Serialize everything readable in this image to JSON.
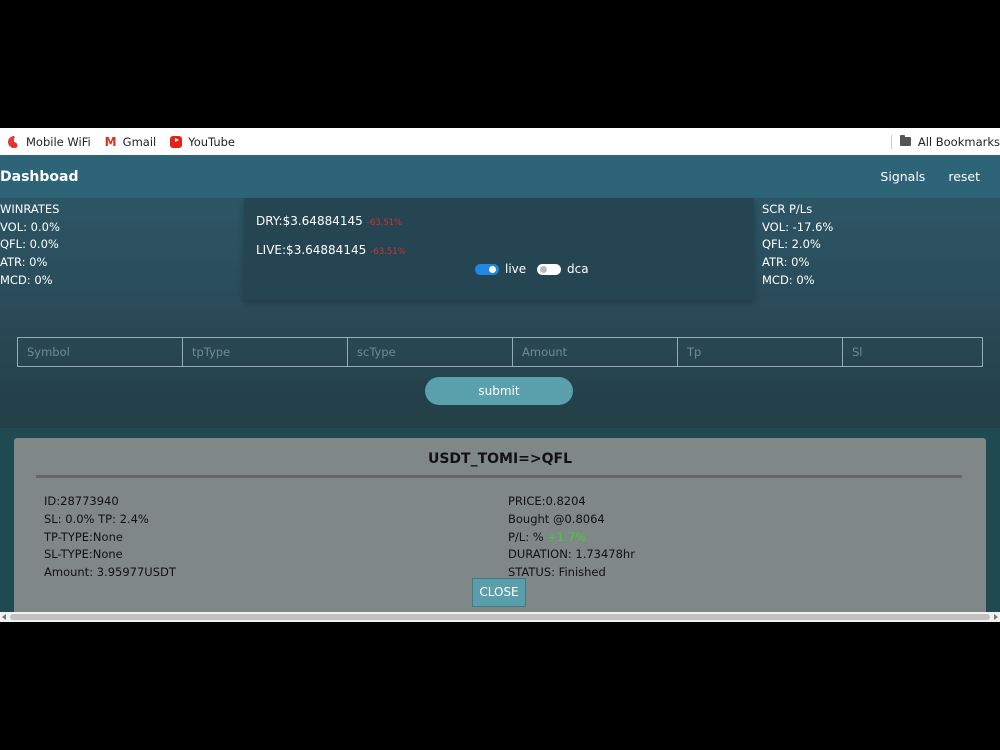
{
  "bookmarks": [
    {
      "label": "Mobile WiFi",
      "icon": "huawei-icon"
    },
    {
      "label": "Gmail",
      "icon": "gmail-icon"
    },
    {
      "label": "YouTube",
      "icon": "youtube-icon"
    }
  ],
  "all_bookmarks": "All Bookmarks",
  "navbar": {
    "brand": "Dashboad",
    "links": [
      "Signals",
      "reset"
    ]
  },
  "winrates": {
    "title": "WINRATES",
    "vol": "VOL: 0.0%",
    "qfl": "QFL: 0.0%",
    "atr": "ATR: 0%",
    "mcd": "MCD: 0%"
  },
  "scr": {
    "title": "SCR P/Ls",
    "vol": "VOL: -17.6%",
    "qfl": "QFL: 2.0%",
    "atr": "ATR: 0%",
    "mcd": "MCD: 0%"
  },
  "balance": {
    "dry": "DRY:$3.64884145",
    "dry_pct": "-63.51%",
    "live": "LIVE:$3.64884145",
    "live_pct": "-63.51%",
    "live_toggle_label": "live",
    "live_on": true,
    "dca_toggle_label": "dca",
    "dca_on": false
  },
  "form": {
    "placeholders": [
      "Symbol",
      "tpType",
      "scType",
      "Amount",
      "Tp",
      "Sl"
    ],
    "submit_label": "submit"
  },
  "trade": {
    "title": "USDT_TOMI=>QFL",
    "id": "ID:28773940",
    "sl_tp": "SL: 0.0% TP: 2.4%",
    "tp_type": "TP-TYPE:None",
    "sl_type": "SL-TYPE:None",
    "amount": "Amount: 3.95977USDT",
    "price": "PRICE:0.8204",
    "bought": "Bought @0.8064",
    "pl_label": "P/L: %",
    "pl_value": "+1.7%",
    "duration": "DURATION: 1.73478hr",
    "status": "STATUS: Finished",
    "close_label": "CLOSE"
  },
  "colors": {
    "navbar": "#2e6478",
    "loss": "#d32f2f",
    "gain": "#3bd13b",
    "accent": "#5aa0ad"
  }
}
